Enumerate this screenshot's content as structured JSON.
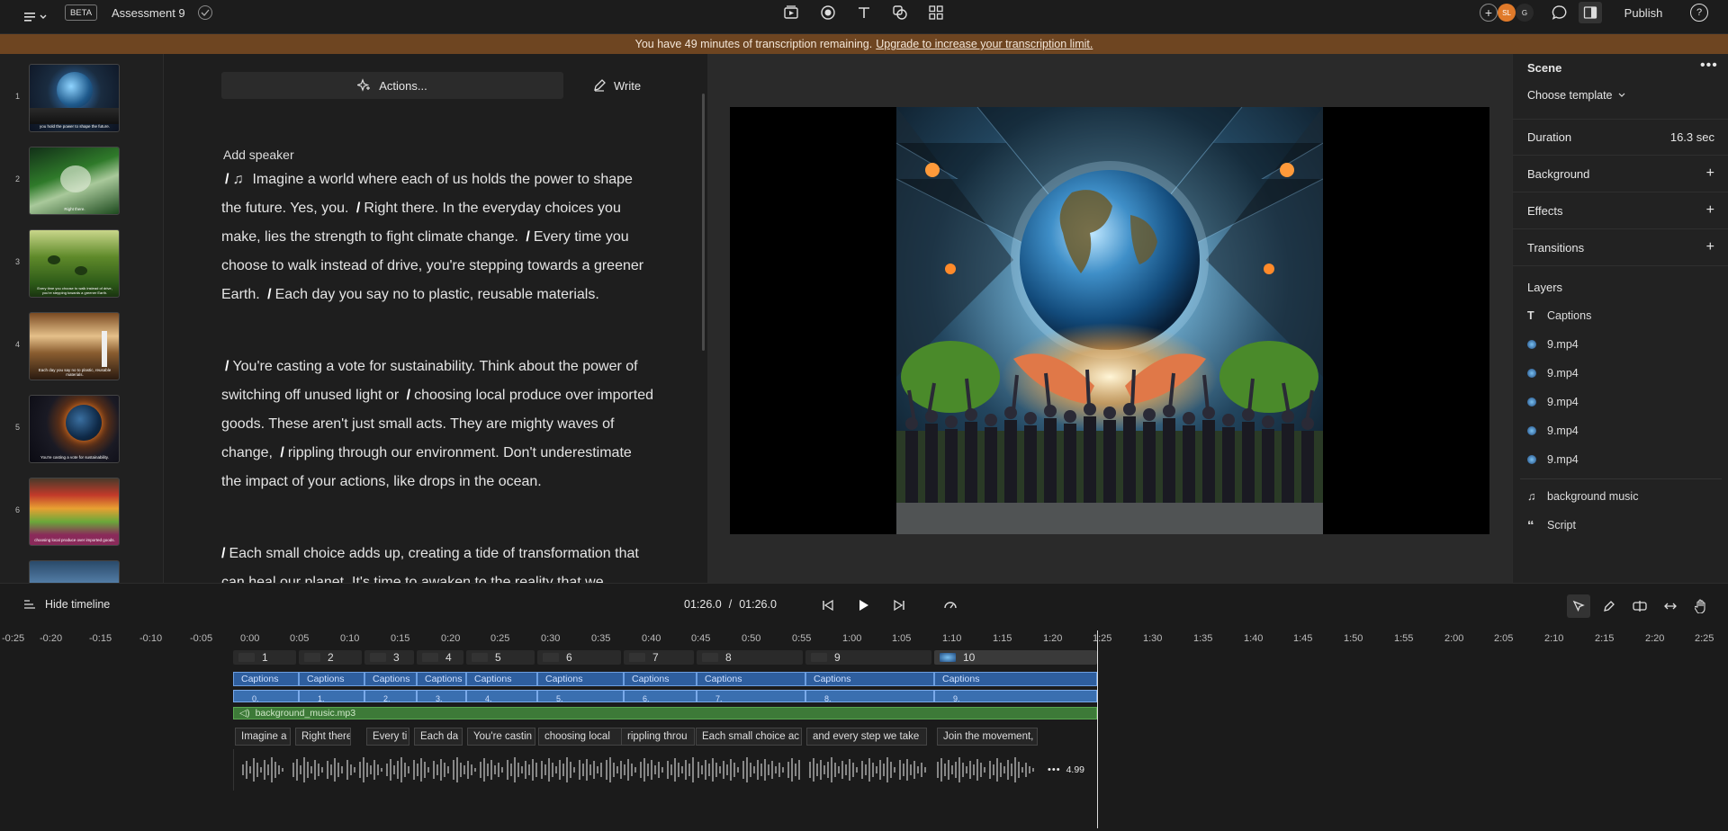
{
  "topbar": {
    "beta": "BETA",
    "project_title": "Assessment 9",
    "publish": "Publish",
    "avatar_initials": "SL",
    "avatar2": "G"
  },
  "banner": {
    "text": "You have 49 minutes of transcription remaining.",
    "link": "Upgrade to increase your transcription limit."
  },
  "thumbnails": [
    {
      "num": "1",
      "caption": "you hold the power to shape the future."
    },
    {
      "num": "2",
      "caption": "Right there."
    },
    {
      "num": "3",
      "caption": "Every time you choose to walk instead of drive, you're stepping towards a greener Earth."
    },
    {
      "num": "4",
      "caption": "Each day you say no to plastic, reusable materials."
    },
    {
      "num": "5",
      "caption": "You're casting a vote for sustainability."
    },
    {
      "num": "6",
      "caption": "choosing local produce over imported goods."
    }
  ],
  "script": {
    "actions": "Actions...",
    "write": "Write",
    "add_speaker": "Add speaker",
    "p1": "Imagine a world where each of us holds the power to shape the future. Yes, you.",
    "p1b": "Right there. In the everyday choices you make, lies the strength to fight climate change.",
    "p1c": "Every time you choose to walk instead of drive, you're stepping towards a greener Earth.",
    "p1d": "Each day you say no to plastic, reusable materials.",
    "p2a": "You're casting a vote for sustainability. Think about the power of switching off unused  light or",
    "p2b": "choosing local produce over imported goods. These aren't just small acts. They are mighty waves of change,",
    "p2c": "rippling through our environment. Don't underestimate the impact of your actions, like drops in the ocean.",
    "p3a": "Each small choice adds up, creating a tide of transformation that can heal our planet. It's time to awaken to the reality that we"
  },
  "right_panel": {
    "scene": "Scene",
    "choose_template": "Choose template",
    "duration_label": "Duration",
    "duration_value": "16.3 sec",
    "background": "Background",
    "effects": "Effects",
    "transitions": "Transitions",
    "layers": "Layers",
    "layer_items": [
      "Captions",
      "9.mp4",
      "9.mp4",
      "9.mp4",
      "9.mp4",
      "9.mp4",
      "background music",
      "Script"
    ]
  },
  "timeline": {
    "hide": "Hide timeline",
    "current": "01:26.0",
    "sep": "/",
    "total": "01:26.0",
    "ruler": [
      "-0:25",
      "-0:20",
      "-0:15",
      "-0:10",
      "-0:05",
      "0:00",
      "0:05",
      "0:10",
      "0:15",
      "0:20",
      "0:25",
      "0:30",
      "0:35",
      "0:40",
      "0:45",
      "0:50",
      "0:55",
      "1:00",
      "1:05",
      "1:10",
      "1:15",
      "1:20",
      "1:25",
      "1:30",
      "1:35",
      "1:40",
      "1:45",
      "1:50",
      "1:55",
      "2:00",
      "2:05",
      "2:10",
      "2:15",
      "2:20",
      "2:25"
    ],
    "scenes": [
      "1",
      "2",
      "3",
      "4",
      "5",
      "6",
      "7",
      "8",
      "9",
      "10"
    ],
    "caption_label": "Captions",
    "video_labels": [
      "0.",
      "1.",
      "2.",
      "3.",
      "4.",
      "5.",
      "6.",
      "7.",
      "8.",
      "9."
    ],
    "music": "background_music.mp3",
    "transcript": [
      "Imagine a",
      "Right there",
      "Every ti",
      "Each da",
      "You're castin",
      "choosing local",
      "rippling throu",
      "Each small choice ac",
      "and every step we take",
      "Join the movement,"
    ],
    "extra_duration": "4.99"
  },
  "colors": {
    "banner": "#6e4521",
    "caption_track": "#2e5e9e",
    "music_track": "#3d7a38"
  }
}
